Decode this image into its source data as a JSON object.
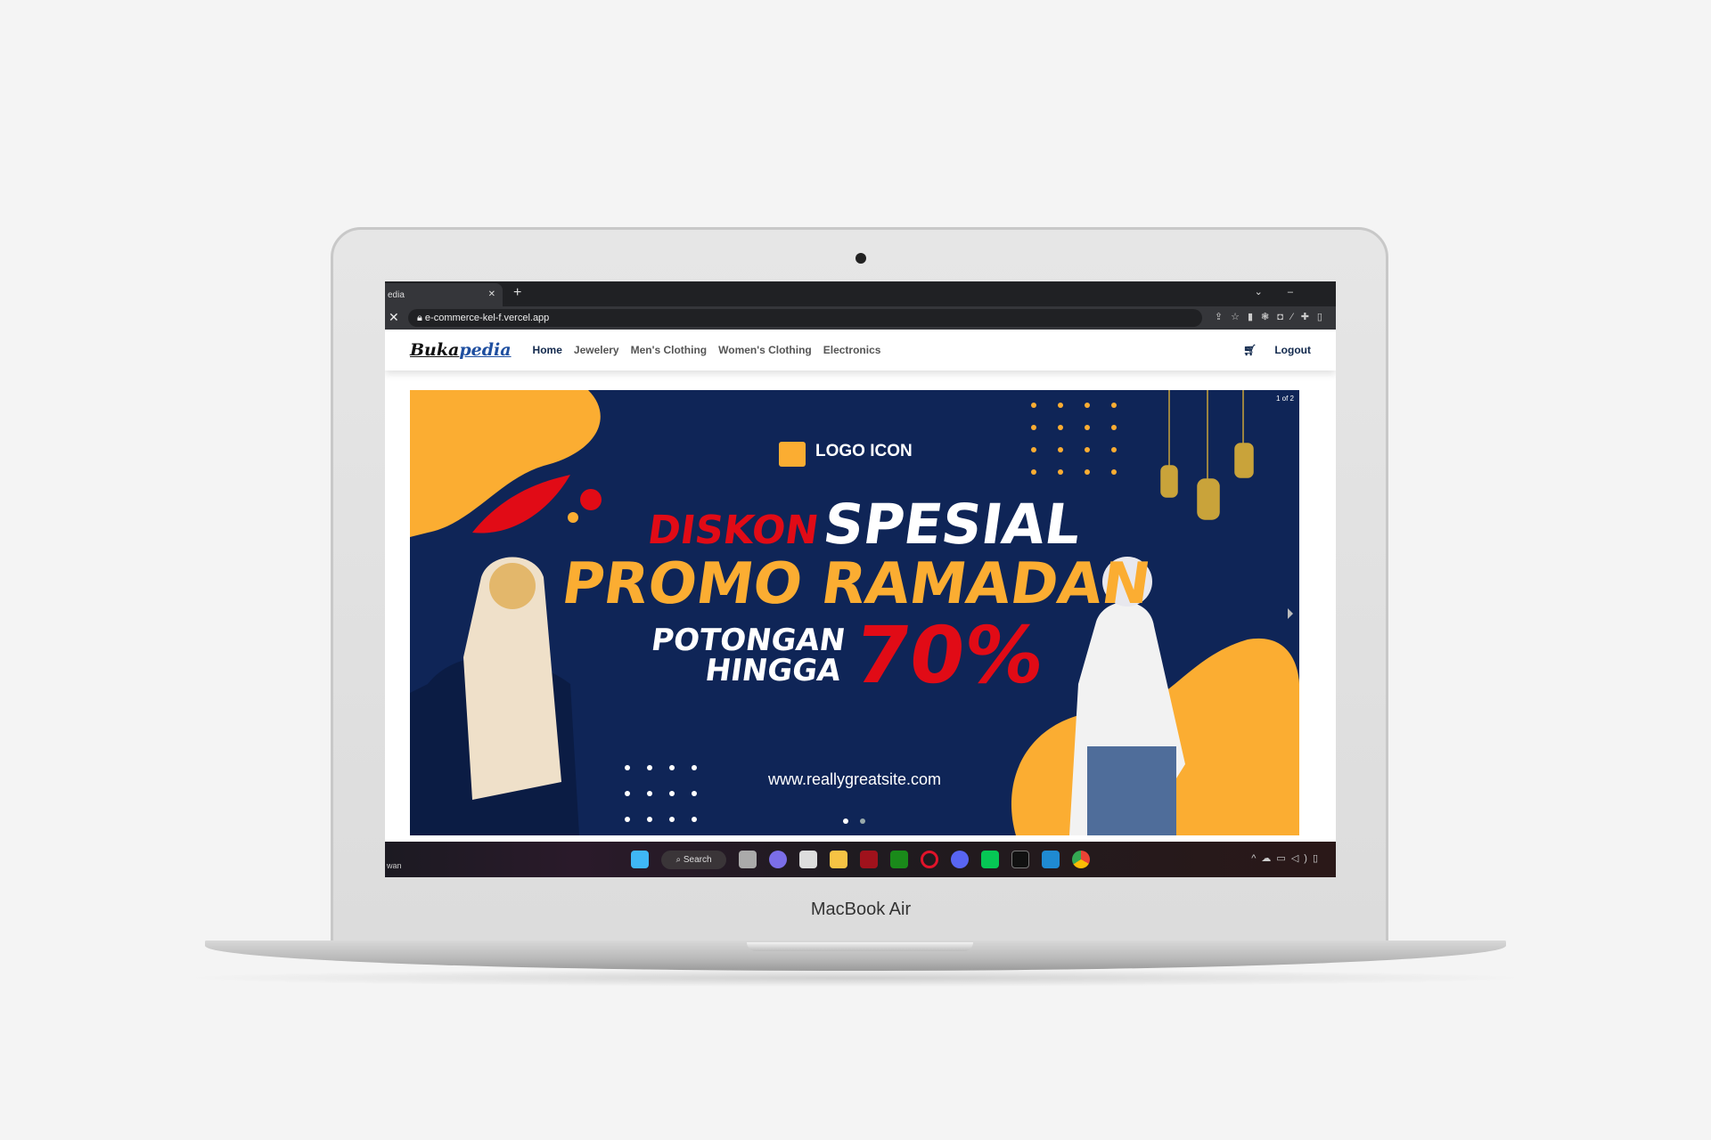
{
  "device": {
    "label": "MacBook Air"
  },
  "browser": {
    "tab_title": "edia",
    "url": "e-commerce-kel-f.vercel.app"
  },
  "site": {
    "logo_a": "Buka",
    "logo_b": "pedia",
    "nav": [
      "Home",
      "Jewelery",
      "Men's Clothing",
      "Women's Clothing",
      "Electronics"
    ],
    "logout": "Logout"
  },
  "banner": {
    "counter": "1 of 2",
    "logo_text": "LOGO ICON",
    "line1a": "DISKON",
    "line1b": "SPESIAL",
    "line2": "PROMO RAMADAN",
    "line3a": "POTONGAN",
    "line3b": "HINGGA",
    "percent": "70%",
    "website": "www.reallygreatsite.com",
    "slide_index": 1,
    "slide_total": 2
  },
  "taskbar": {
    "search": "Search",
    "user": "wan"
  },
  "colors": {
    "navy": "#0f2557",
    "orange": "#fbad32",
    "red": "#e10b16"
  }
}
